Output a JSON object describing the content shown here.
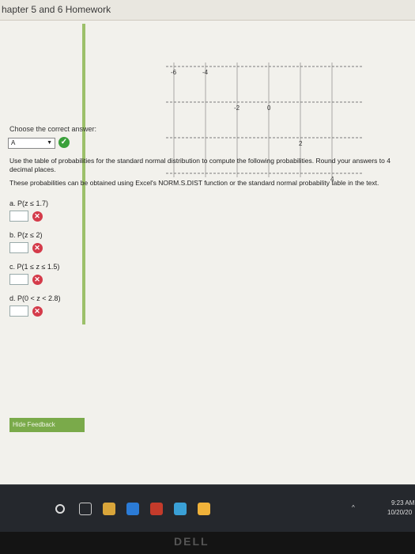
{
  "window": {
    "title": "hapter 5 and 6 Homework"
  },
  "number_line": {
    "tick_labels": [
      "-6",
      "-4",
      "-2",
      "0",
      "2",
      "4"
    ]
  },
  "question": {
    "choose_label": "Choose the correct answer:",
    "selected_answer": "A",
    "instruction_1": "Use the table of probabilities for the standard normal distribution to compute the following probabilities. Round your answers to 4 decimal places.",
    "instruction_2": "These probabilities can be obtained using Excel's NORM.S.DIST function or the standard normal probability table in the text.",
    "parts": [
      {
        "label": "a. P(z ≤ 1.7)",
        "value": ""
      },
      {
        "label": "b. P(z ≤ 2)",
        "value": ""
      },
      {
        "label": "c. P(1 ≤ z ≤ 1.5)",
        "value": ""
      },
      {
        "label": "d. P(0 < z < 2.8)",
        "value": ""
      }
    ]
  },
  "feedback": {
    "hide_label": "Hide Feedback"
  },
  "taskbar": {
    "time": "9:23 AM",
    "date": "10/20/20"
  },
  "bezel": {
    "brand": "DELL"
  },
  "colors": {
    "correct": "#3aa03a",
    "incorrect": "#d43b4a",
    "feedback": "#7aaa4a"
  }
}
